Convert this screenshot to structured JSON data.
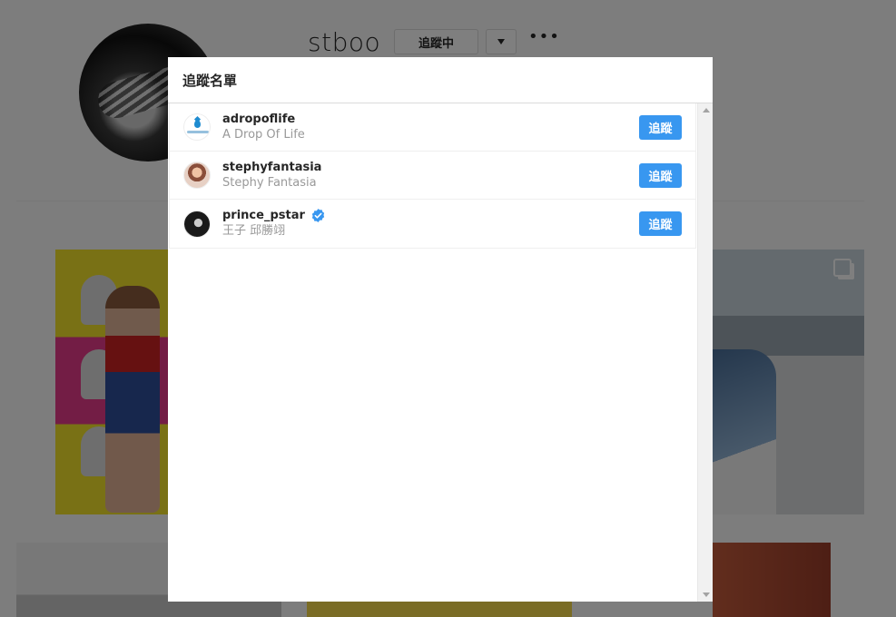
{
  "profile": {
    "username": "stboo",
    "following_label": "追蹤中",
    "dropdown_icon": "caret-down-icon",
    "more_icon": "more-options-icon"
  },
  "modal": {
    "title": "追蹤名單",
    "users": [
      {
        "handle": "adropoflife",
        "full_name": "A Drop Of Life",
        "verified": false,
        "button": "追蹤"
      },
      {
        "handle": "stephyfantasia",
        "full_name": "Stephy Fantasia",
        "verified": false,
        "button": "追蹤"
      },
      {
        "handle": "prince_pstar",
        "full_name": "王子 邱勝翊",
        "verified": true,
        "button": "追蹤"
      }
    ]
  },
  "colors": {
    "accent": "#3897f0",
    "overlay": "rgba(0,0,0,0.5)"
  }
}
